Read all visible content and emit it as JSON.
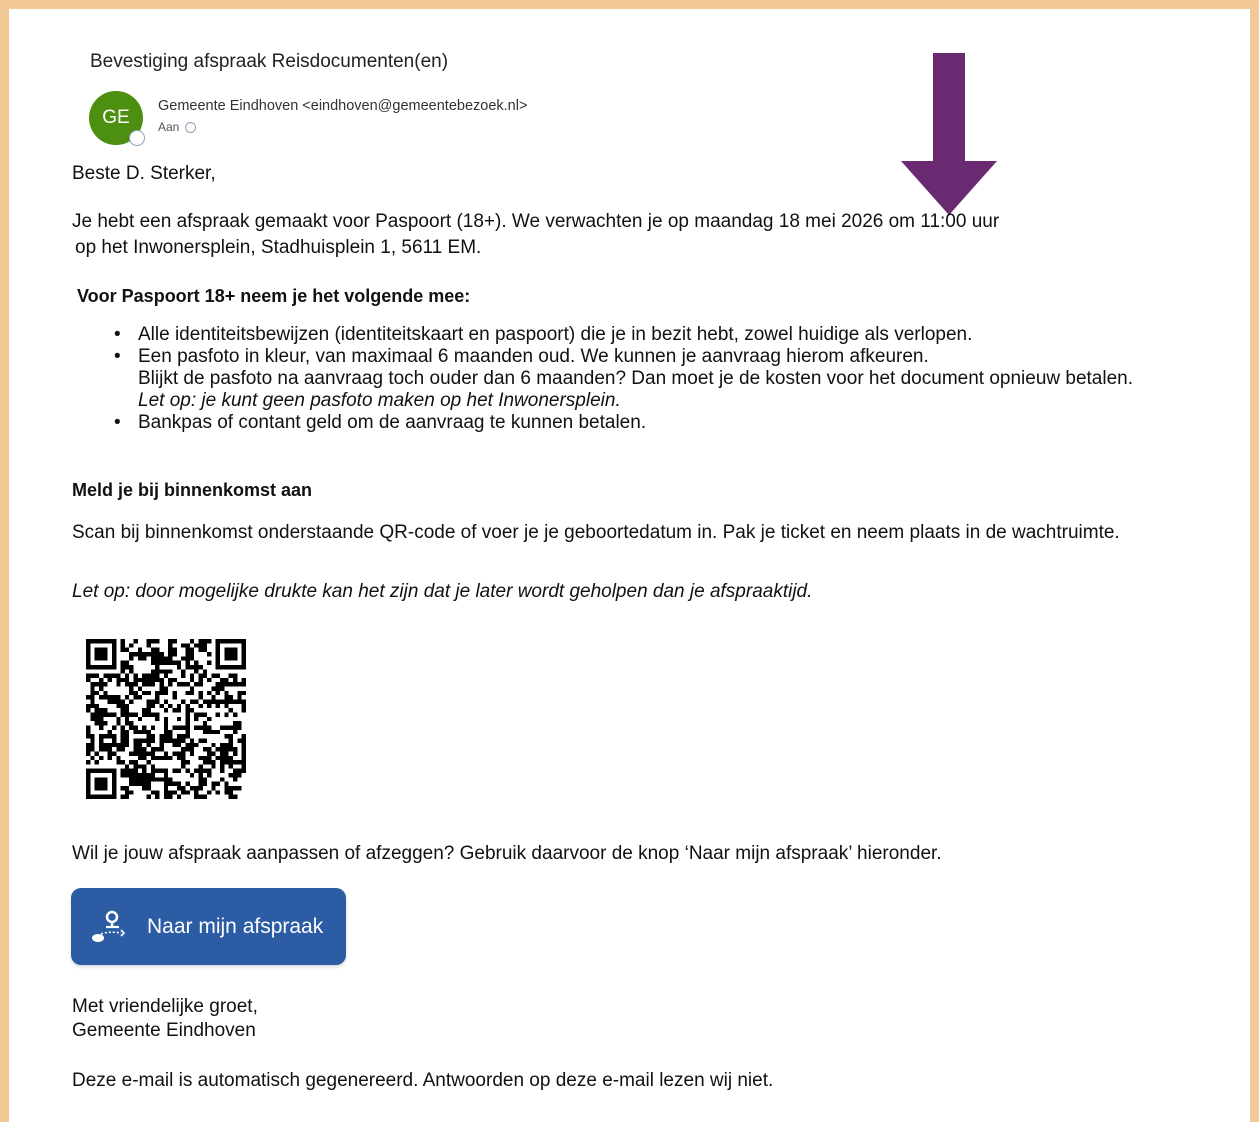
{
  "email": {
    "subject": "Bevestiging afspraak Reisdocumenten(en)",
    "avatar_initials": "GE",
    "sender": "Gemeente Eindhoven <eindhoven@gemeentebezoek.nl>",
    "to_label": "Aan"
  },
  "body": {
    "greeting": "Beste D. Sterker,",
    "intro_line1": "Je hebt een afspraak gemaakt voor Paspoort (18+). We verwachten je op maandag 18 mei 2026 om 11:00 uur",
    "intro_line2": "op het Inwonersplein, Stadhuisplein 1, 5611 EM.",
    "section1_title": "Voor Paspoort 18+ neem je het volgende mee:",
    "bullets": [
      {
        "line1": "Alle identiteitsbewijzen (identiteitskaart en paspoort) die je in bezit hebt, zowel huidige als verlopen."
      },
      {
        "line1": "Een pasfoto in kleur, van maximaal 6 maanden oud. We kunnen je aanvraag hierom afkeuren.",
        "line2": "Blijkt de pasfoto na aanvraag toch ouder dan 6 maanden? Dan moet je de kosten voor het document opnieuw betalen.",
        "line3": "Let op: je kunt geen pasfoto maken op het Inwonersplein."
      },
      {
        "line1": "Bankpas of contant geld om de aanvraag te kunnen betalen."
      }
    ],
    "section2_title": "Meld je bij binnenkomst aan",
    "scan_text": "Scan bij binnenkomst onderstaande QR-code of voer je je geboortedatum in. Pak je ticket en neem plaats in de wachtruimte.",
    "note_text": "Let op: door mogelijke drukte kan het zijn dat je later wordt geholpen dan je afspraaktijd.",
    "adjust_text": "Wil je jouw afspraak aanpassen of afzeggen? Gebruik daarvoor de knop ‘Naar mijn afspraak’ hieronder.",
    "cta_label": "Naar mijn afspraak",
    "cta_icon": "route-pin-icon",
    "closing_line1": "Met vriendelijke groet,",
    "closing_line2": "Gemeente Eindhoven",
    "footer_text": "Deze e-mail is automatisch gegenereerd. Antwoorden op deze e-mail lezen wij niet."
  },
  "colors": {
    "frame": "#f1c896",
    "avatar": "#4d8f10",
    "arrow": "#6a2a72",
    "button": "#2b5ca4"
  }
}
